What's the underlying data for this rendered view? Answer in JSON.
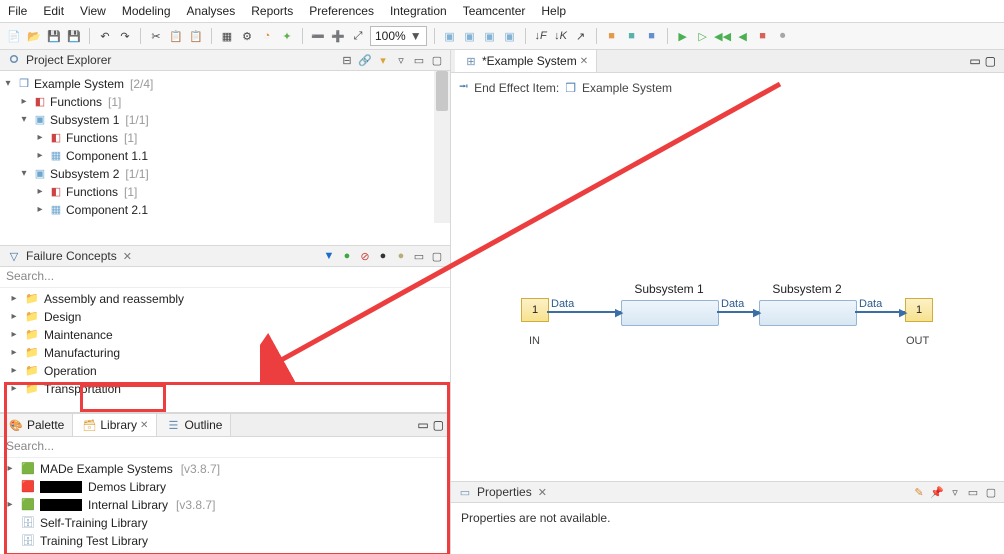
{
  "menu": [
    "File",
    "Edit",
    "View",
    "Modeling",
    "Analyses",
    "Reports",
    "Preferences",
    "Integration",
    "Teamcenter",
    "Help"
  ],
  "toolbar": {
    "zoom": "100%"
  },
  "project_explorer": {
    "title": "Project Explorer",
    "root": {
      "label": "Example System",
      "count": "[2/4]"
    },
    "children": [
      {
        "label": "Functions",
        "count": "[1]"
      },
      {
        "label": "Subsystem 1",
        "count": "[1/1]",
        "children": [
          {
            "label": "Functions",
            "count": "[1]"
          },
          {
            "label": "Component 1.1"
          }
        ]
      },
      {
        "label": "Subsystem 2",
        "count": "[1/1]",
        "children": [
          {
            "label": "Functions",
            "count": "[1]"
          },
          {
            "label": "Component 2.1"
          }
        ]
      }
    ]
  },
  "failure_concepts": {
    "title": "Failure Concepts",
    "search_placeholder": "Search...",
    "items": [
      "Assembly and reassembly",
      "Design",
      "Maintenance",
      "Manufacturing",
      "Operation",
      "Transportation"
    ]
  },
  "bottom_tabs": {
    "palette": "Palette",
    "library": "Library",
    "outline": "Outline",
    "search_placeholder": "Search...",
    "items": [
      {
        "label": "MADe Example Systems",
        "ver": "[v3.8.7]",
        "icon": "green"
      },
      {
        "label": "Demos Library",
        "icon": "red",
        "redacted": true
      },
      {
        "label": "Internal Library",
        "ver": "[v3.8.7]",
        "icon": "green",
        "redacted": true
      },
      {
        "label": "Self-Training Library",
        "icon": "db"
      },
      {
        "label": "Training Test Library",
        "icon": "db"
      }
    ]
  },
  "editor": {
    "tab": "*Example System",
    "breadcrumb_label": "End Effect Item:",
    "breadcrumb_value": "Example System",
    "nodes": {
      "in": {
        "num": "1",
        "label": "IN"
      },
      "out": {
        "num": "1",
        "label": "OUT"
      },
      "s1": "Subsystem 1",
      "s2": "Subsystem 2",
      "edge": "Data"
    }
  },
  "properties": {
    "title": "Properties",
    "body": "Properties are not available."
  }
}
